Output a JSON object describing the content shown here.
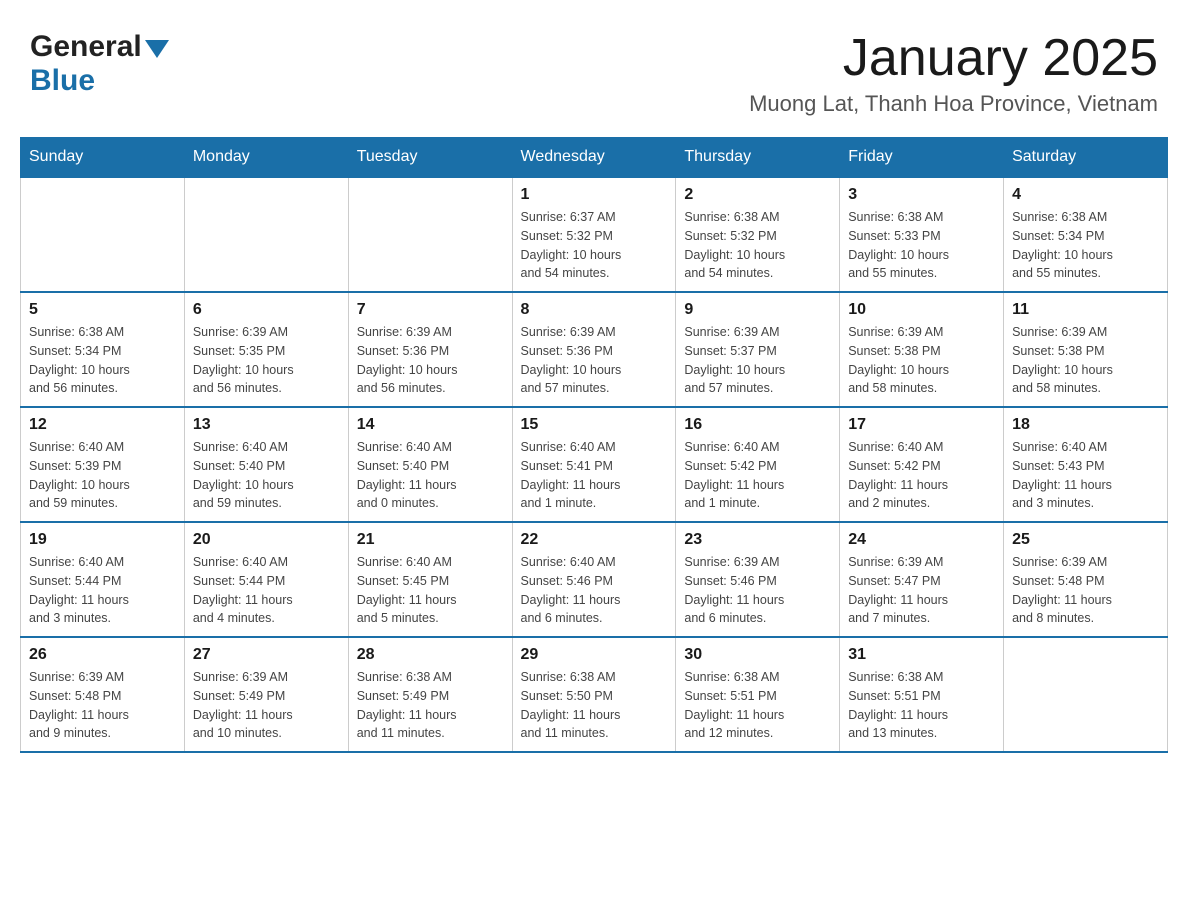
{
  "header": {
    "logo_general": "General",
    "logo_blue": "Blue",
    "month_title": "January 2025",
    "location": "Muong Lat, Thanh Hoa Province, Vietnam"
  },
  "days_of_week": [
    "Sunday",
    "Monday",
    "Tuesday",
    "Wednesday",
    "Thursday",
    "Friday",
    "Saturday"
  ],
  "weeks": [
    {
      "days": [
        {
          "num": "",
          "info": ""
        },
        {
          "num": "",
          "info": ""
        },
        {
          "num": "",
          "info": ""
        },
        {
          "num": "1",
          "info": "Sunrise: 6:37 AM\nSunset: 5:32 PM\nDaylight: 10 hours\nand 54 minutes."
        },
        {
          "num": "2",
          "info": "Sunrise: 6:38 AM\nSunset: 5:32 PM\nDaylight: 10 hours\nand 54 minutes."
        },
        {
          "num": "3",
          "info": "Sunrise: 6:38 AM\nSunset: 5:33 PM\nDaylight: 10 hours\nand 55 minutes."
        },
        {
          "num": "4",
          "info": "Sunrise: 6:38 AM\nSunset: 5:34 PM\nDaylight: 10 hours\nand 55 minutes."
        }
      ]
    },
    {
      "days": [
        {
          "num": "5",
          "info": "Sunrise: 6:38 AM\nSunset: 5:34 PM\nDaylight: 10 hours\nand 56 minutes."
        },
        {
          "num": "6",
          "info": "Sunrise: 6:39 AM\nSunset: 5:35 PM\nDaylight: 10 hours\nand 56 minutes."
        },
        {
          "num": "7",
          "info": "Sunrise: 6:39 AM\nSunset: 5:36 PM\nDaylight: 10 hours\nand 56 minutes."
        },
        {
          "num": "8",
          "info": "Sunrise: 6:39 AM\nSunset: 5:36 PM\nDaylight: 10 hours\nand 57 minutes."
        },
        {
          "num": "9",
          "info": "Sunrise: 6:39 AM\nSunset: 5:37 PM\nDaylight: 10 hours\nand 57 minutes."
        },
        {
          "num": "10",
          "info": "Sunrise: 6:39 AM\nSunset: 5:38 PM\nDaylight: 10 hours\nand 58 minutes."
        },
        {
          "num": "11",
          "info": "Sunrise: 6:39 AM\nSunset: 5:38 PM\nDaylight: 10 hours\nand 58 minutes."
        }
      ]
    },
    {
      "days": [
        {
          "num": "12",
          "info": "Sunrise: 6:40 AM\nSunset: 5:39 PM\nDaylight: 10 hours\nand 59 minutes."
        },
        {
          "num": "13",
          "info": "Sunrise: 6:40 AM\nSunset: 5:40 PM\nDaylight: 10 hours\nand 59 minutes."
        },
        {
          "num": "14",
          "info": "Sunrise: 6:40 AM\nSunset: 5:40 PM\nDaylight: 11 hours\nand 0 minutes."
        },
        {
          "num": "15",
          "info": "Sunrise: 6:40 AM\nSunset: 5:41 PM\nDaylight: 11 hours\nand 1 minute."
        },
        {
          "num": "16",
          "info": "Sunrise: 6:40 AM\nSunset: 5:42 PM\nDaylight: 11 hours\nand 1 minute."
        },
        {
          "num": "17",
          "info": "Sunrise: 6:40 AM\nSunset: 5:42 PM\nDaylight: 11 hours\nand 2 minutes."
        },
        {
          "num": "18",
          "info": "Sunrise: 6:40 AM\nSunset: 5:43 PM\nDaylight: 11 hours\nand 3 minutes."
        }
      ]
    },
    {
      "days": [
        {
          "num": "19",
          "info": "Sunrise: 6:40 AM\nSunset: 5:44 PM\nDaylight: 11 hours\nand 3 minutes."
        },
        {
          "num": "20",
          "info": "Sunrise: 6:40 AM\nSunset: 5:44 PM\nDaylight: 11 hours\nand 4 minutes."
        },
        {
          "num": "21",
          "info": "Sunrise: 6:40 AM\nSunset: 5:45 PM\nDaylight: 11 hours\nand 5 minutes."
        },
        {
          "num": "22",
          "info": "Sunrise: 6:40 AM\nSunset: 5:46 PM\nDaylight: 11 hours\nand 6 minutes."
        },
        {
          "num": "23",
          "info": "Sunrise: 6:39 AM\nSunset: 5:46 PM\nDaylight: 11 hours\nand 6 minutes."
        },
        {
          "num": "24",
          "info": "Sunrise: 6:39 AM\nSunset: 5:47 PM\nDaylight: 11 hours\nand 7 minutes."
        },
        {
          "num": "25",
          "info": "Sunrise: 6:39 AM\nSunset: 5:48 PM\nDaylight: 11 hours\nand 8 minutes."
        }
      ]
    },
    {
      "days": [
        {
          "num": "26",
          "info": "Sunrise: 6:39 AM\nSunset: 5:48 PM\nDaylight: 11 hours\nand 9 minutes."
        },
        {
          "num": "27",
          "info": "Sunrise: 6:39 AM\nSunset: 5:49 PM\nDaylight: 11 hours\nand 10 minutes."
        },
        {
          "num": "28",
          "info": "Sunrise: 6:38 AM\nSunset: 5:49 PM\nDaylight: 11 hours\nand 11 minutes."
        },
        {
          "num": "29",
          "info": "Sunrise: 6:38 AM\nSunset: 5:50 PM\nDaylight: 11 hours\nand 11 minutes."
        },
        {
          "num": "30",
          "info": "Sunrise: 6:38 AM\nSunset: 5:51 PM\nDaylight: 11 hours\nand 12 minutes."
        },
        {
          "num": "31",
          "info": "Sunrise: 6:38 AM\nSunset: 5:51 PM\nDaylight: 11 hours\nand 13 minutes."
        },
        {
          "num": "",
          "info": ""
        }
      ]
    }
  ]
}
